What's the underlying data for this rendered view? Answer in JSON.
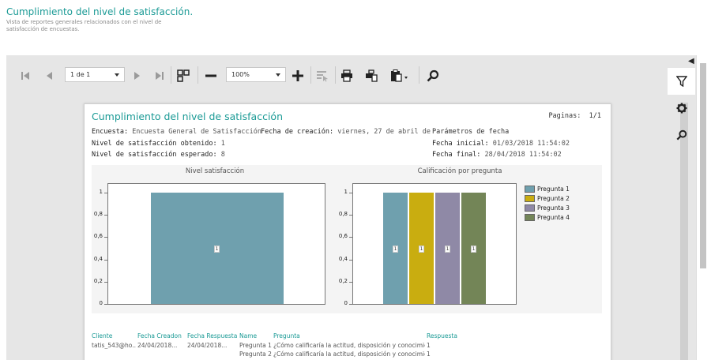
{
  "header": {
    "title": "Cumplimiento del nivel de satisfacción.",
    "subtitle": "Vista de reportes generales relacionados con el nivel de satisfacción de encuestas."
  },
  "toolbar": {
    "page_select": "1 de 1",
    "zoom_select": "100%"
  },
  "report": {
    "title": "Cumplimiento del nivel de satisfacción",
    "pages_label": "Paginas:",
    "pages_value": "1/1",
    "encuesta_label": "Encuesta:",
    "encuesta_value": "Encuesta General de Satisfacción",
    "fecha_creacion_label": "Fecha de creación:",
    "fecha_creacion_value": "viernes, 27 de abril de",
    "parametros_label": "Parámetros de fecha",
    "obtenido_label": "Nivel de satisfacción obtenido:",
    "obtenido_value": "1",
    "esperado_label": "Nivel de satisfacción esperado:",
    "esperado_value": "8",
    "fecha_inicial_label": "Fecha inicial:",
    "fecha_inicial_value": "01/03/2018 11:54:02",
    "fecha_final_label": "Fecha final:",
    "fecha_final_value": "28/04/2018 11:54:02"
  },
  "chart_data": [
    {
      "type": "bar",
      "title": "Nivel satisfacción",
      "categories": [
        ""
      ],
      "values": [
        1
      ],
      "data_labels": [
        "1"
      ],
      "ylim": [
        0,
        1
      ],
      "yticks": [
        "0",
        "0,2",
        "0,4",
        "0,6",
        "0,8",
        "1"
      ],
      "colors": [
        "#6fa0ae"
      ]
    },
    {
      "type": "bar",
      "title": "Calificación por pregunta",
      "categories": [
        "Pregunta 1",
        "Pregunta 2",
        "Pregunta 3",
        "Pregunta 4"
      ],
      "series": [
        {
          "name": "Pregunta 1",
          "values": [
            1
          ],
          "color": "#6fa0ae"
        },
        {
          "name": "Pregunta 2",
          "values": [
            1
          ],
          "color": "#c9ad10"
        },
        {
          "name": "Pregunta 3",
          "values": [
            1
          ],
          "color": "#8f89a6"
        },
        {
          "name": "Pregunta 4",
          "values": [
            1
          ],
          "color": "#738557"
        }
      ],
      "data_labels": [
        "1",
        "1",
        "1",
        "1"
      ],
      "ylim": [
        0,
        1
      ],
      "yticks": [
        "0",
        "0,2",
        "0,4",
        "0,6",
        "0,8",
        "1"
      ],
      "legend": "right"
    }
  ],
  "table": {
    "headers": [
      "Cliente",
      "Fecha Creadon",
      "Fecha Respuesta",
      "Name",
      "Pregunta",
      "Respuesta"
    ],
    "rows": [
      [
        "tatis_543@ho...",
        "24/04/2018...",
        "24/04/2018...",
        "Pregunta 1",
        "¿Cómo calificaría la actitud, disposición y conocimiento",
        "1"
      ],
      [
        "",
        "",
        "",
        "Pregunta 2",
        "¿Cómo calificaría la actitud, disposición y conocimiento",
        "1"
      ]
    ]
  },
  "icons": [
    "first-page-icon",
    "prev-page-icon",
    "next-page-icon",
    "last-page-icon",
    "multipage-icon",
    "zoom-out-icon",
    "zoom-in-icon",
    "select-tool-icon",
    "print-icon",
    "print-page-icon",
    "export-icon",
    "search-icon",
    "filter-icon",
    "gear-icon",
    "collapse-icon"
  ],
  "colors": {
    "accent": "#1a9a95"
  }
}
